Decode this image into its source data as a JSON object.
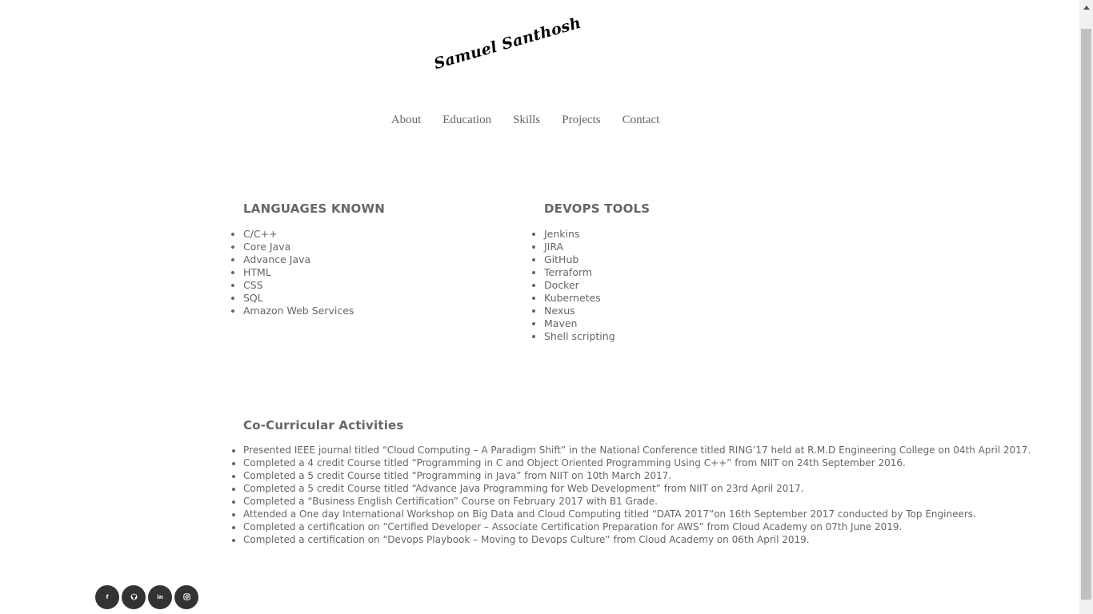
{
  "logo": {
    "text": "Samuel Santhosh"
  },
  "nav": {
    "items": [
      "About",
      "Education",
      "Skills",
      "Projects",
      "Contact"
    ]
  },
  "languages": {
    "title": "LANGUAGES KNOWN",
    "items": [
      "C/C++",
      "Core Java",
      "Advance Java",
      "HTML",
      "CSS",
      "SQL",
      "Amazon Web Services"
    ]
  },
  "devops": {
    "title": "DEVOPS TOOLS",
    "items": [
      "Jenkins",
      "JIRA",
      "GitHub",
      "Terraform",
      "Docker",
      "Kubernetes",
      "Nexus",
      "Maven",
      "Shell scripting"
    ]
  },
  "activities": {
    "title": "Co-Curricular Activities",
    "items": [
      "Presented IEEE journal titled “Cloud Computing – A Paradigm Shift” in the National Conference titled RING’17 held at R.M.D Engineering College on 04th April 2017.",
      "Completed a 4 credit Course titled “Programming in C and Object Oriented Programming Using C++” from NIIT on 24th September 2016.",
      "Completed a 5 credit Course titled “Programming in Java” from NIIT on 10th March 2017.",
      "Completed a 5 credit Course titled “Advance Java Programming for Web Development” from NIIT on 23rd April 2017.",
      "Completed a “Business English Certification” Course on February 2017 with B1 Grade.",
      "Attended a One day International Workshop on Big Data and Cloud Computing titled “DATA 2017”on 16th September 2017 conducted by Top Engineers.",
      "Completed a certification on “Certified Developer – Associate Certification Preparation for AWS” from Cloud Academy on 07th June 2019.",
      "Completed a certification on “Devops Playbook – Moving to Devops Culture” from Cloud Academy on 06th April 2019."
    ]
  },
  "socials": {
    "facebook": "f",
    "github": "github-icon",
    "linkedin": "in",
    "instagram": "instagram-icon"
  }
}
